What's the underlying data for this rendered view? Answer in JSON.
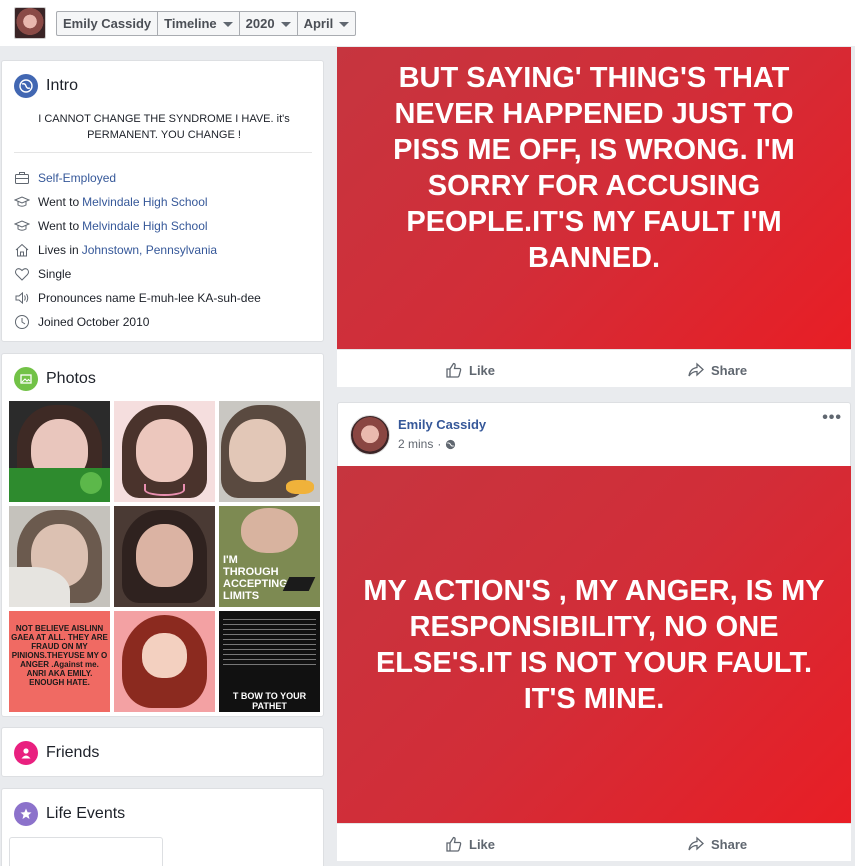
{
  "top_bar": {
    "profile_name": "Emily Cassidy",
    "menu_timeline": "Timeline",
    "menu_year": "2020",
    "menu_month": "April"
  },
  "intro": {
    "title": "Intro",
    "bio": "I CANNOT CHANGE THE SYNDROME I HAVE. it's PERMANENT. YOU CHANGE !",
    "work": "Self-Employed",
    "education_1_prefix": "Went to",
    "education_1_school": "Melvindale High School",
    "education_2_prefix": "Went to",
    "education_2_school": "Melvindale High School",
    "lives_prefix": "Lives in",
    "lives_place": "Johnstown, Pennsylvania",
    "relationship": "Single",
    "pronunciation": "Pronounces name E-muh-lee KA-suh-dee",
    "joined": "Joined October 2010"
  },
  "photos": {
    "title": "Photos",
    "photo_8_text": "I'M THROUGH ACCEPTING LIMITS",
    "photo_7_text": "NOT BELIEVE AISLINN GAEA AT ALL. THEY ARE FRAUD ON MY PINIONS.THEYUSE MY O ANGER .Against me. ANRI AKA EMILY. ENOUGH HATE.",
    "photo_9_text": "T BOW TO YOUR PATHET"
  },
  "friends": {
    "title": "Friends"
  },
  "life_events": {
    "title": "Life Events"
  },
  "posts": [
    {
      "text": "BUT SAYING' THING'S THAT NEVER HAPPENED JUST TO PISS ME OFF, IS WRONG. I'M SORRY FOR ACCUSING PEOPLE.IT'S MY FAULT I'M BANNED.",
      "like_label": "Like",
      "share_label": "Share"
    },
    {
      "author": "Emily Cassidy",
      "time": "2 mins",
      "separator": "·",
      "more": "•••",
      "text": "MY ACTION'S , MY ANGER, IS MY RESPONSIBILITY, NO ONE ELSE'S.IT IS NOT YOUR FAULT. IT'S MINE.",
      "like_label": "Like",
      "share_label": "Share"
    }
  ],
  "colors": {
    "post_background": "#d22d38",
    "link": "#365899",
    "page_background": "#e9ebee"
  }
}
